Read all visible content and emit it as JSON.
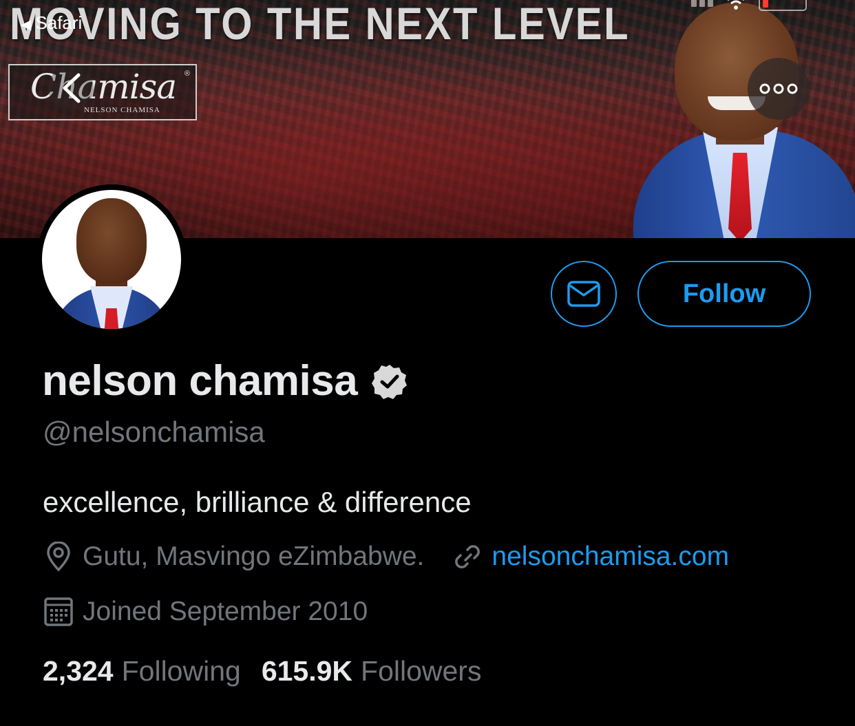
{
  "status_bar": {
    "back_app": "Safari"
  },
  "banner": {
    "headline": "MOVING TO THE NEXT LEVEL",
    "logo_script": "Chamisa",
    "logo_subtitle": "NELSON CHAMISA",
    "logo_mark": "®"
  },
  "nav": {
    "back_icon": "chevron-left-icon",
    "more_icon": "more-horizontal-icon"
  },
  "profile": {
    "display_name": "nelson chamisa",
    "verified": true,
    "handle": "@nelsonchamisa",
    "bio": "excellence, brilliance & difference",
    "location": "Gutu, Masvingo eZimbabwe.",
    "website": "nelsonchamisa.com",
    "joined": "Joined September 2010"
  },
  "actions": {
    "message_icon": "envelope-icon",
    "follow_label": "Follow"
  },
  "stats": {
    "following_count": "2,324",
    "following_label": "Following",
    "followers_count": "615.9K",
    "followers_label": "Followers"
  },
  "colors": {
    "accent": "#1d9bf0",
    "background": "#000000",
    "primary_text": "#e7e9ea",
    "secondary_text": "#71767b"
  }
}
